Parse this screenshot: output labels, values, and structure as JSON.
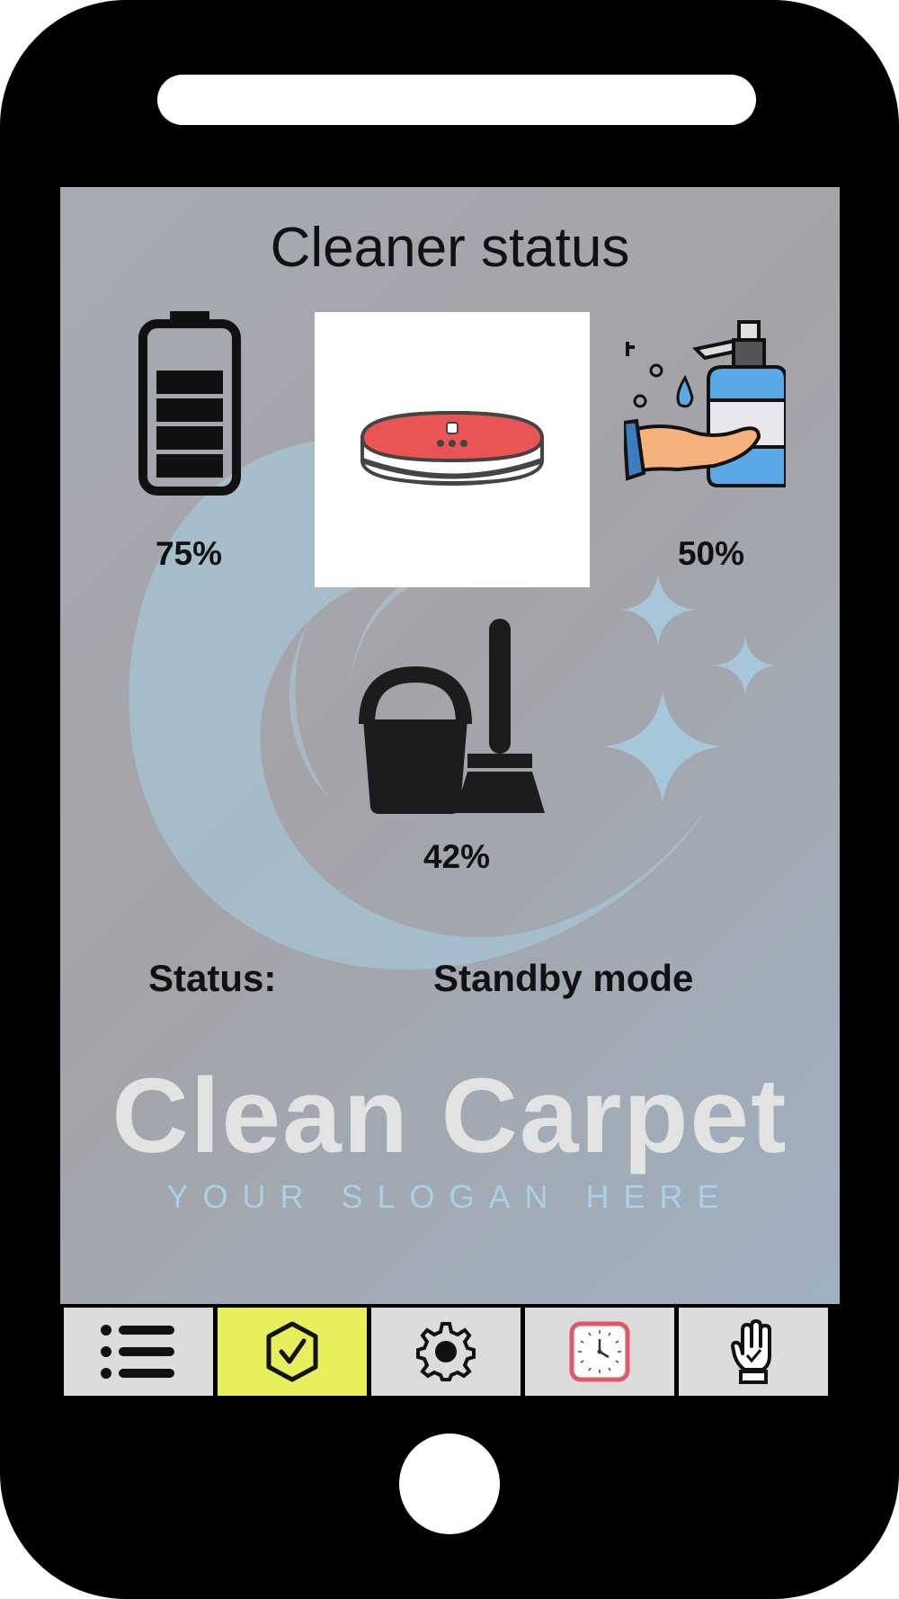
{
  "screen": {
    "title": "Cleaner status"
  },
  "metrics": {
    "battery": {
      "label": "75%",
      "value": 75,
      "icon": "battery-icon"
    },
    "robot": {
      "icon": "robot-vacuum-icon"
    },
    "detergent": {
      "label": "50%",
      "value": 50,
      "icon": "soap-dispenser-icon"
    },
    "cleaning": {
      "label": "42%",
      "value": 42,
      "icon": "bucket-broom-icon"
    }
  },
  "status": {
    "key": "Status:",
    "value": "Standby mode"
  },
  "brand": {
    "name": "Clean Carpet",
    "slogan": "YOUR SLOGAN HERE"
  },
  "tabs": [
    {
      "icon": "list-icon",
      "active": false
    },
    {
      "icon": "shield-check-icon",
      "active": true
    },
    {
      "icon": "gear-icon",
      "active": false
    },
    {
      "icon": "clock-icon",
      "active": false
    },
    {
      "icon": "hand-icon",
      "active": false
    }
  ],
  "colors": {
    "active_tab": "#e8ef5c",
    "tab": "#dcdcdc",
    "robot_red": "#ea5455",
    "soap_blue": "#5aa9e6",
    "clock_red": "#e05a66"
  }
}
